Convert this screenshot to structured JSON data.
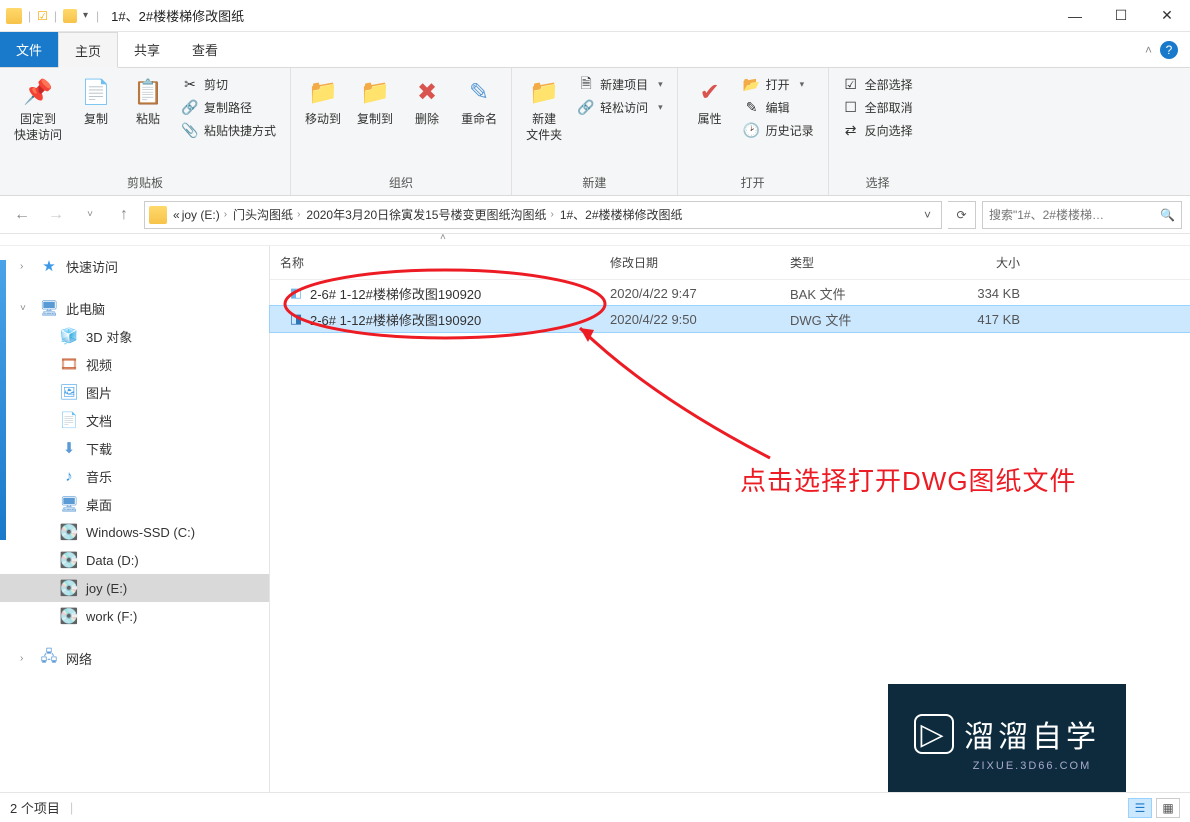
{
  "window": {
    "title": "1#、2#楼楼梯修改图纸"
  },
  "tabs": {
    "file": "文件",
    "home": "主页",
    "share": "共享",
    "view": "查看"
  },
  "ribbon": {
    "pin": "固定到\n快速访问",
    "copy": "复制",
    "paste": "粘贴",
    "cut": "剪切",
    "copypath": "复制路径",
    "pasteshortcut": "粘贴快捷方式",
    "clipboard_label": "剪贴板",
    "moveto": "移动到",
    "copyto": "复制到",
    "delete": "删除",
    "rename": "重命名",
    "organize_label": "组织",
    "newfolder": "新建\n文件夹",
    "newitem": "新建项目",
    "easyaccess": "轻松访问",
    "new_label": "新建",
    "properties": "属性",
    "open": "打开",
    "edit": "编辑",
    "history": "历史记录",
    "open_label": "打开",
    "selectall": "全部选择",
    "selectnone": "全部取消",
    "invert": "反向选择",
    "select_label": "选择"
  },
  "breadcrumb": {
    "prefix": "«",
    "parts": [
      "joy (E:)",
      "门头沟图纸",
      "2020年3月20日徐寅发15号楼变更图纸沟图纸",
      "1#、2#楼楼梯修改图纸"
    ]
  },
  "search": {
    "placeholder": "搜索\"1#、2#楼楼梯…"
  },
  "columns": {
    "name": "名称",
    "date": "修改日期",
    "type": "类型",
    "size": "大小"
  },
  "nav": {
    "quick": "快速访问",
    "thispc": "此电脑",
    "objects3d": "3D 对象",
    "videos": "视频",
    "pictures": "图片",
    "documents": "文档",
    "downloads": "下载",
    "music": "音乐",
    "desktop": "桌面",
    "cdrive": "Windows-SSD (C:)",
    "ddrive": "Data (D:)",
    "edrive": "joy (E:)",
    "fdrive": "work (F:)",
    "network": "网络"
  },
  "files": [
    {
      "name": "2-6# 1-12#楼梯修改图190920",
      "date": "2020/4/22 9:47",
      "type": "BAK 文件",
      "size": "334 KB",
      "icon_color": "#5b9bd5"
    },
    {
      "name": "2-6# 1-12#楼梯修改图190920",
      "date": "2020/4/22 9:50",
      "type": "DWG 文件",
      "size": "417 KB",
      "icon_color": "#2e75b6"
    }
  ],
  "annotation": "点击选择打开DWG图纸文件",
  "status": {
    "count": "2 个项目"
  },
  "watermark": {
    "main": "溜溜自学",
    "sub": "ZIXUE.3D66.COM"
  }
}
